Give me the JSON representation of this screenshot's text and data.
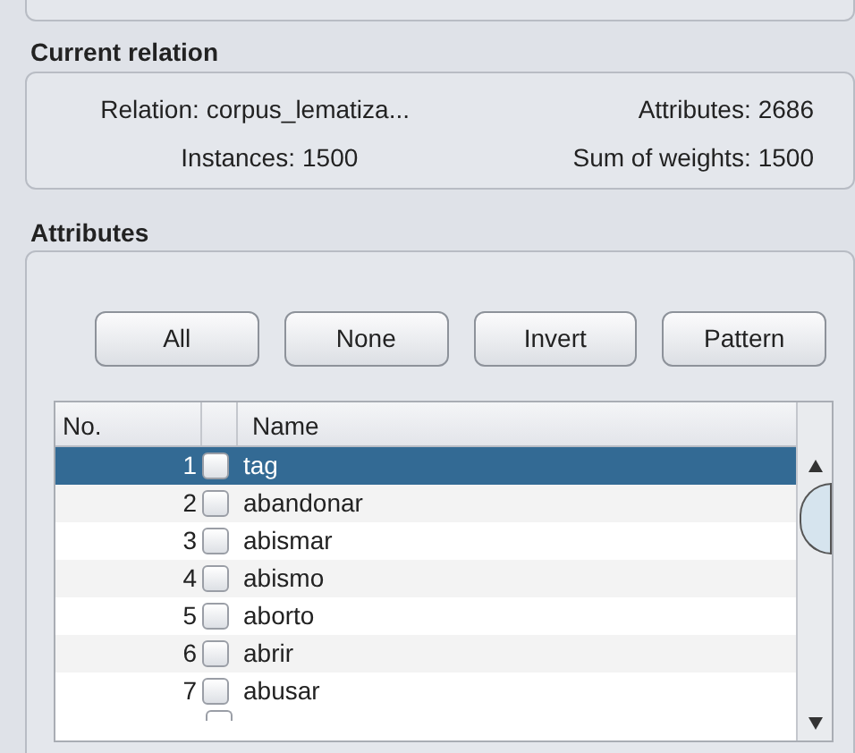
{
  "current_relation": {
    "title": "Current relation",
    "relation_label": "Relation:",
    "relation": "corpus_lematiza...",
    "attributes_label": "Attributes:",
    "attributes": "2686",
    "instances_label": "Instances:",
    "instances": "1500",
    "sum_label": "Sum of weights:",
    "sum": "1500"
  },
  "attributes": {
    "title": "Attributes",
    "buttons": [
      "All",
      "None",
      "Invert",
      "Pattern"
    ],
    "table": {
      "columns": [
        "No.",
        "Name"
      ],
      "rows": [
        {
          "no": "1",
          "name": "tag",
          "checked": false,
          "selected": true
        },
        {
          "no": "2",
          "name": "abandonar",
          "checked": false,
          "selected": false
        },
        {
          "no": "3",
          "name": "abismar",
          "checked": false,
          "selected": false
        },
        {
          "no": "4",
          "name": "abismo",
          "checked": false,
          "selected": false
        },
        {
          "no": "5",
          "name": "aborto",
          "checked": false,
          "selected": false
        },
        {
          "no": "6",
          "name": "abrir",
          "checked": false,
          "selected": false
        },
        {
          "no": "7",
          "name": "abusar",
          "checked": false,
          "selected": false
        }
      ]
    }
  }
}
